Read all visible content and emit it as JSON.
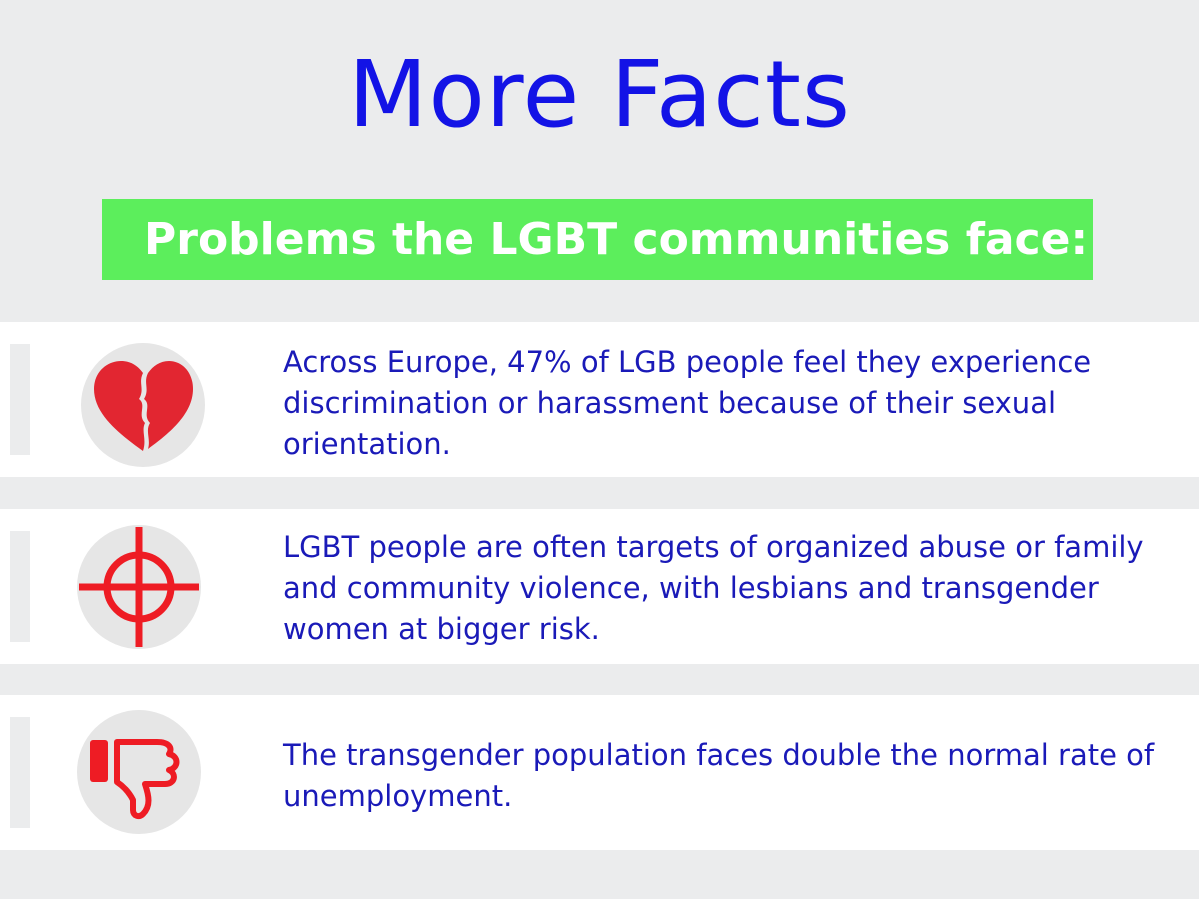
{
  "title": "More Facts",
  "banner": {
    "text": "Problems the LGBT communities face:"
  },
  "facts": [
    {
      "icon": "broken-heart-icon",
      "text": "Across Europe, 47% of LGB people feel they experience discrimination or harassment because of their sexual orientation."
    },
    {
      "icon": "crosshair-target-icon",
      "text": "LGBT people are often targets of organized abuse or family and community violence, with lesbians and transgender women at bigger risk."
    },
    {
      "icon": "thumbs-down-icon",
      "text": "The transgender population faces double the normal rate of unemployment."
    }
  ],
  "colors": {
    "background": "#ebeced",
    "title": "#1313e6",
    "banner": "#5cee5c",
    "text": "#1a1ab8",
    "icon_red": "#e8192c",
    "icon_circle": "#e6e6e6"
  }
}
